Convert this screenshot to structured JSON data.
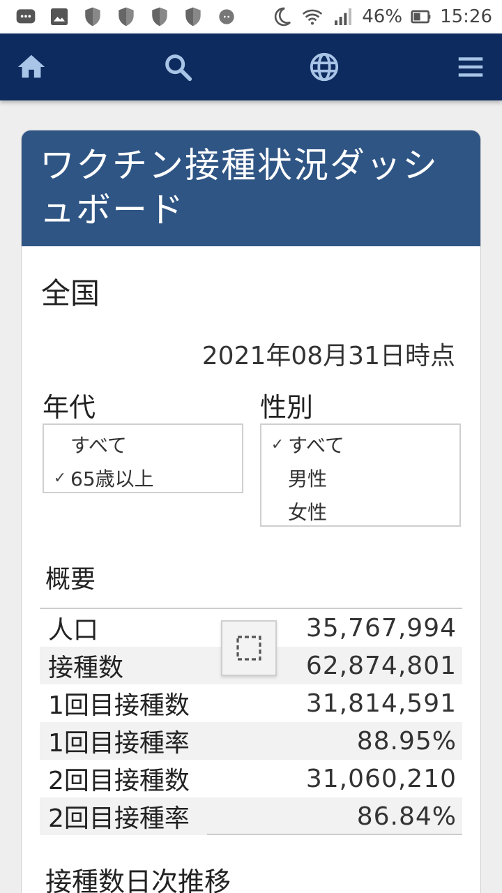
{
  "status_bar": {
    "battery": "46%",
    "time": "15:26",
    "icons": [
      "message-icon",
      "image-icon",
      "shield-icon",
      "shield-icon",
      "shield-icon",
      "shield-icon",
      "sheep-icon",
      "moon-icon",
      "wifi-icon",
      "signal-icon",
      "battery-icon"
    ]
  },
  "nav": {
    "icons": [
      "home-icon",
      "search-icon",
      "globe-icon",
      "menu-icon"
    ],
    "color": "#0d2b5e"
  },
  "card": {
    "title": "ワクチン接種状況ダッシュボード",
    "header_color": "#2f5584",
    "region": "全国",
    "date": "2021年08月31日時点"
  },
  "filters": {
    "age": {
      "label": "年代",
      "options": [
        {
          "label": "すべて",
          "checked": false
        },
        {
          "label": "65歳以上",
          "checked": true
        }
      ]
    },
    "sex": {
      "label": "性別",
      "options": [
        {
          "label": "すべて",
          "checked": true
        },
        {
          "label": "男性",
          "checked": false
        },
        {
          "label": "女性",
          "checked": false
        }
      ]
    }
  },
  "summary": {
    "title": "概要",
    "rows": [
      {
        "label": "人口",
        "value": "35,767,994"
      },
      {
        "label": "接種数",
        "value": "62,874,801"
      },
      {
        "label": "1回目接種数",
        "value": "31,814,591"
      },
      {
        "label": "1回目接種率",
        "value": "88.95%"
      },
      {
        "label": "2回目接種数",
        "value": "31,060,210"
      },
      {
        "label": "2回目接種率",
        "value": "86.84%"
      }
    ]
  },
  "trend": {
    "title": "接種数日次推移"
  }
}
